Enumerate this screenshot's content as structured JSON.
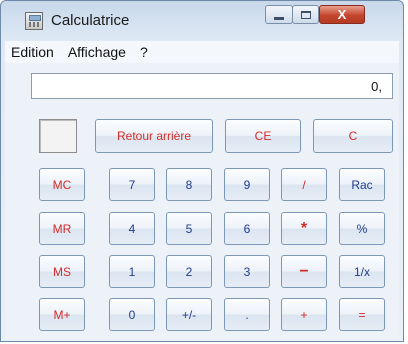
{
  "window": {
    "title": "Calculatrice",
    "close_glyph": "X"
  },
  "menu": {
    "items": [
      "Edition",
      "Affichage",
      "?"
    ]
  },
  "display": {
    "value": "0,"
  },
  "top_row": {
    "backspace": "Retour arrière",
    "ce": "CE",
    "c": "C"
  },
  "memory": {
    "mc": "MC",
    "mr": "MR",
    "ms": "MS",
    "mplus": "M+"
  },
  "keys": {
    "k7": "7",
    "k8": "8",
    "k9": "9",
    "div": "/",
    "sqrt": "Rac",
    "k4": "4",
    "k5": "5",
    "k6": "6",
    "mul": "*",
    "pct": "%",
    "k1": "1",
    "k2": "2",
    "k3": "3",
    "sub": "−",
    "inv": "1/x",
    "k0": "0",
    "sign": "+/-",
    "dec": ".",
    "add": "+",
    "eq": "="
  },
  "colors": {
    "operator_text": "#d42a2a",
    "digit_text": "#203c8f"
  }
}
